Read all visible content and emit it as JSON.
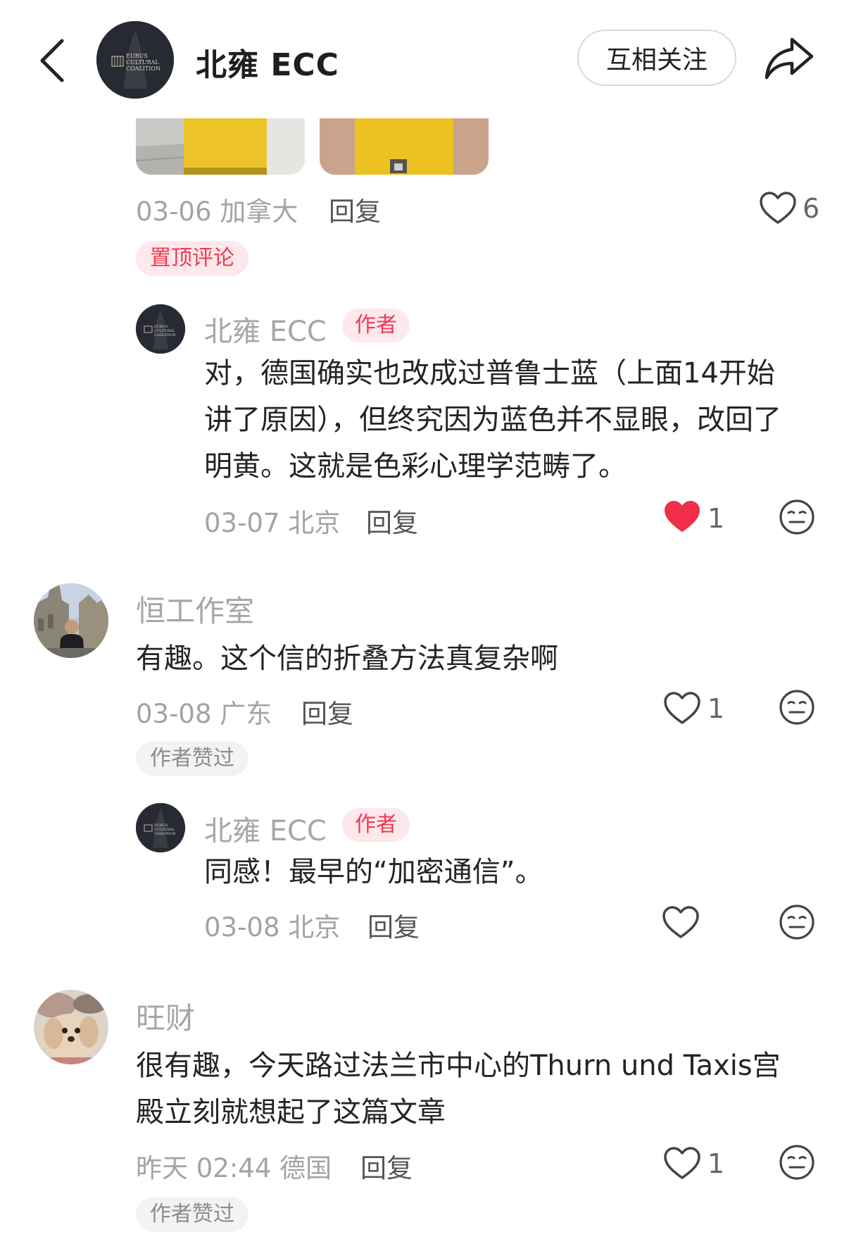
{
  "header": {
    "title": "北雍 ECC",
    "follow_label": "互相关注",
    "logo_text": "EURUS CULTURAL COALITION",
    "back_icon": "chevron-left-icon",
    "share_icon": "share-arrow-icon"
  },
  "pinned_comment": {
    "date_location": "03-06 加拿大",
    "reply_label": "回复",
    "like_count": "6",
    "pinned_tag": "置顶评论"
  },
  "comments": [
    {
      "author": "北雍 ECC",
      "author_tag": "作者",
      "lines": [
        "对，德国确实也改成过普鲁士蓝（上面14开始",
        "讲了原因），但终究因为蓝色并不显眼，改回了",
        "明黄。这就是色彩心理学范畴了。"
      ],
      "date_location": "03-07 北京",
      "reply_label": "回复",
      "like_count": "1",
      "liked": true
    },
    {
      "author": "恒工作室",
      "lines": [
        "有趣。这个信的折叠方法真复杂啊"
      ],
      "date_location": "03-08 广东",
      "reply_label": "回复",
      "like_count": "1",
      "liked": false,
      "badge": "作者赞过"
    },
    {
      "author": "北雍 ECC",
      "author_tag": "作者",
      "lines": [
        "同感！最早的“加密通信”。"
      ],
      "date_location": "03-08 北京",
      "reply_label": "回复",
      "like_count": "",
      "liked": false
    },
    {
      "author": "旺财",
      "lines": [
        "很有趣，今天路过法兰市中心的Thurn und Taxis宫",
        "殿立刻就想起了这篇文章"
      ],
      "date_location": "昨天 02:44 德国",
      "reply_label": "回复",
      "like_count": "1",
      "liked": false,
      "badge": "作者赞过"
    }
  ],
  "colors": {
    "accent_red": "#ee3b53",
    "meta_gray": "#a3a3a3",
    "tag_pink_bg": "#fde8ec",
    "avatar_dark": "#272a33"
  }
}
